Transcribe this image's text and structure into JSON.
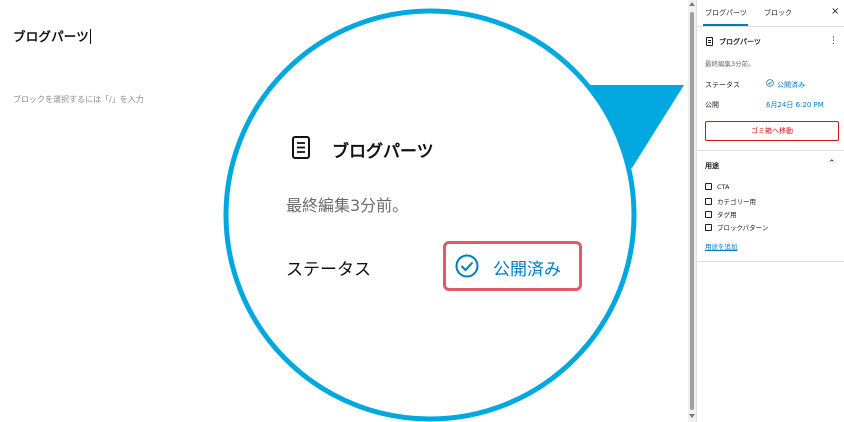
{
  "editor": {
    "post_title": "ブログパーツ",
    "block_placeholder": "ブロックを選択するには「/」を入力"
  },
  "sidebar": {
    "tabs": [
      {
        "label": "ブログパーツ",
        "active": true
      },
      {
        "label": "ブロック",
        "active": false
      }
    ],
    "close_icon": "×",
    "post_name": "ブログパーツ",
    "more_icon": "⋮",
    "last_edited": "最終編集3分前。",
    "status_label": "ステータス",
    "status_value": "公開済み",
    "publish_label": "公開",
    "publish_value": "6月24日 6:20 PM",
    "trash_button": "ゴミ箱へ移動",
    "usage_section": {
      "title": "用途",
      "categories": [
        {
          "label": "CTA",
          "checked": false
        },
        {
          "label": "カテゴリー用",
          "checked": false
        },
        {
          "label": "タグ用",
          "checked": false
        },
        {
          "label": "ブロックパターン",
          "checked": false
        }
      ],
      "add_link": "用途を追加"
    }
  },
  "zoom_callout": {
    "title": "ブログパーツ",
    "last_edited": "最終編集3分前。",
    "status_label": "ステータス",
    "status_value": "公開済み",
    "accent_color": "#00a8e0",
    "highlight_color": "#e05a62",
    "link_color": "#007cba"
  }
}
